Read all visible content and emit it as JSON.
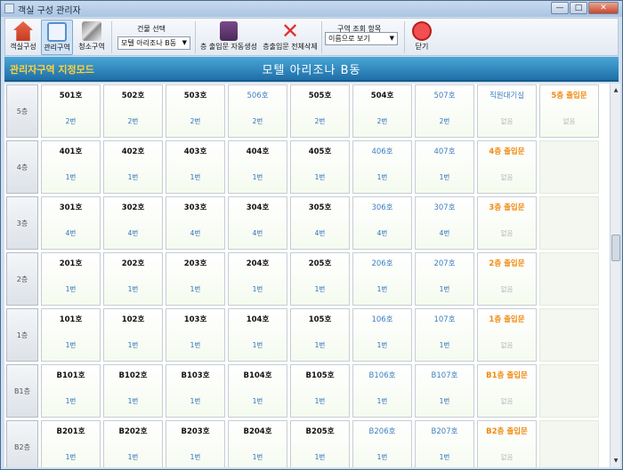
{
  "window": {
    "title": "객실 구성 관리자",
    "btn_min": "—",
    "btn_max": "□",
    "btn_close": "✕"
  },
  "toolbar": {
    "room_config": "객실구성",
    "manage_zone": "관리구역",
    "clean_zone": "청소구역",
    "building_select_label": "건물 선택",
    "building_value": "모텔 아리조나 B동",
    "auto_create": "층 출입문 자동생성",
    "delete_all": "층출입문 전체삭제",
    "zone_view_label": "구역 조회 항목",
    "zone_view_value": "이름으로 보기",
    "close": "닫기"
  },
  "band": {
    "mode": "관리자구역 지정모드",
    "building": "모텔 아리조나 B동"
  },
  "floors": [
    {
      "label": "5층",
      "rooms": [
        {
          "name": "501호",
          "area": "2번",
          "style": ""
        },
        {
          "name": "502호",
          "area": "2번",
          "style": ""
        },
        {
          "name": "503호",
          "area": "2번",
          "style": ""
        },
        {
          "name": "506호",
          "area": "2번",
          "style": "blue"
        },
        {
          "name": "505호",
          "area": "2번",
          "style": ""
        },
        {
          "name": "504호",
          "area": "2번",
          "style": ""
        },
        {
          "name": "507호",
          "area": "2번",
          "style": "blue"
        },
        {
          "name": "직원대기실",
          "area": "없음",
          "style": "staff"
        },
        {
          "name": "5층 출입문",
          "area": "없음",
          "style": "door"
        }
      ]
    },
    {
      "label": "4층",
      "rooms": [
        {
          "name": "401호",
          "area": "1번",
          "style": ""
        },
        {
          "name": "402호",
          "area": "1번",
          "style": ""
        },
        {
          "name": "403호",
          "area": "1번",
          "style": ""
        },
        {
          "name": "404호",
          "area": "1번",
          "style": ""
        },
        {
          "name": "405호",
          "area": "1번",
          "style": ""
        },
        {
          "name": "406호",
          "area": "1번",
          "style": "blue"
        },
        {
          "name": "407호",
          "area": "1번",
          "style": "blue"
        },
        {
          "name": "4층 출입문",
          "area": "없음",
          "style": "door"
        }
      ]
    },
    {
      "label": "3층",
      "rooms": [
        {
          "name": "301호",
          "area": "4번",
          "style": ""
        },
        {
          "name": "302호",
          "area": "4번",
          "style": ""
        },
        {
          "name": "303호",
          "area": "4번",
          "style": ""
        },
        {
          "name": "304호",
          "area": "4번",
          "style": ""
        },
        {
          "name": "305호",
          "area": "4번",
          "style": ""
        },
        {
          "name": "306호",
          "area": "4번",
          "style": "blue"
        },
        {
          "name": "307호",
          "area": "4번",
          "style": "blue"
        },
        {
          "name": "3층 출입문",
          "area": "없음",
          "style": "door"
        }
      ]
    },
    {
      "label": "2층",
      "rooms": [
        {
          "name": "201호",
          "area": "1번",
          "style": ""
        },
        {
          "name": "202호",
          "area": "1번",
          "style": ""
        },
        {
          "name": "203호",
          "area": "1번",
          "style": ""
        },
        {
          "name": "204호",
          "area": "1번",
          "style": ""
        },
        {
          "name": "205호",
          "area": "1번",
          "style": ""
        },
        {
          "name": "206호",
          "area": "1번",
          "style": "blue"
        },
        {
          "name": "207호",
          "area": "1번",
          "style": "blue"
        },
        {
          "name": "2층 출입문",
          "area": "없음",
          "style": "door"
        }
      ]
    },
    {
      "label": "1층",
      "rooms": [
        {
          "name": "101호",
          "area": "1번",
          "style": ""
        },
        {
          "name": "102호",
          "area": "1번",
          "style": ""
        },
        {
          "name": "103호",
          "area": "1번",
          "style": ""
        },
        {
          "name": "104호",
          "area": "1번",
          "style": ""
        },
        {
          "name": "105호",
          "area": "1번",
          "style": ""
        },
        {
          "name": "106호",
          "area": "1번",
          "style": "blue"
        },
        {
          "name": "107호",
          "area": "1번",
          "style": "blue"
        },
        {
          "name": "1층 출입문",
          "area": "없음",
          "style": "door"
        }
      ]
    },
    {
      "label": "B1층",
      "rooms": [
        {
          "name": "B101호",
          "area": "1번",
          "style": ""
        },
        {
          "name": "B102호",
          "area": "1번",
          "style": ""
        },
        {
          "name": "B103호",
          "area": "1번",
          "style": ""
        },
        {
          "name": "B104호",
          "area": "1번",
          "style": ""
        },
        {
          "name": "B105호",
          "area": "1번",
          "style": ""
        },
        {
          "name": "B106호",
          "area": "1번",
          "style": "blue"
        },
        {
          "name": "B107호",
          "area": "1번",
          "style": "blue"
        },
        {
          "name": "B1층 출입문",
          "area": "없음",
          "style": "door"
        }
      ]
    },
    {
      "label": "B2층",
      "rooms": [
        {
          "name": "B201호",
          "area": "1번",
          "style": ""
        },
        {
          "name": "B202호",
          "area": "1번",
          "style": ""
        },
        {
          "name": "B203호",
          "area": "1번",
          "style": ""
        },
        {
          "name": "B204호",
          "area": "1번",
          "style": ""
        },
        {
          "name": "B205호",
          "area": "1번",
          "style": ""
        },
        {
          "name": "B206호",
          "area": "1번",
          "style": "blue"
        },
        {
          "name": "B207호",
          "area": "1번",
          "style": "blue"
        },
        {
          "name": "B2층 출입문",
          "area": "없음",
          "style": "door"
        }
      ]
    }
  ]
}
